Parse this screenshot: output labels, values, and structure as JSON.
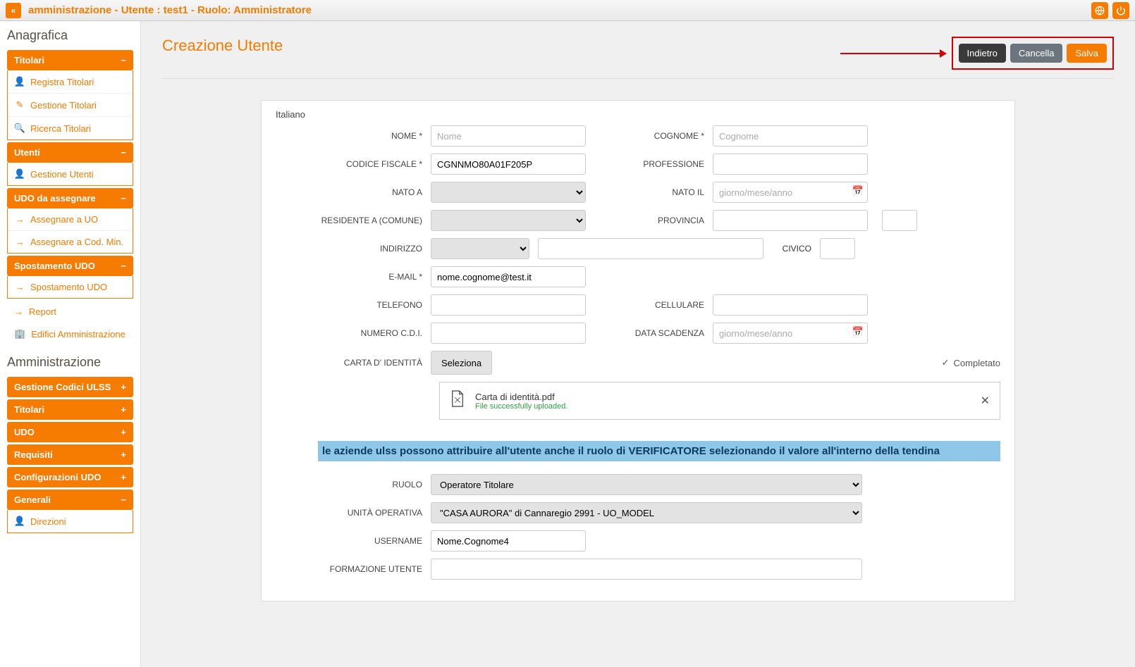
{
  "topbar": {
    "title": "amministrazione - Utente : test1 - Ruolo: Amministratore"
  },
  "sidebar": {
    "heading1": "Anagrafica",
    "titolari": {
      "label": "Titolari",
      "items": [
        "Registra Titolari",
        "Gestione Titolari",
        "Ricerca Titolari"
      ]
    },
    "utenti": {
      "label": "Utenti",
      "items": [
        "Gestione Utenti"
      ]
    },
    "udo_ass": {
      "label": "UDO da assegnare",
      "items": [
        "Assegnare a UO",
        "Assegnare a Cod. Min."
      ]
    },
    "spost": {
      "label": "Spostamento UDO",
      "items": [
        "Spostamento UDO"
      ]
    },
    "report": "Report",
    "edifici": "Edifici Amministrazione",
    "heading2": "Amministrazione",
    "admin": [
      "Gestione Codici ULSS",
      "Titolari",
      "UDO",
      "Requisiti",
      "Configurazioni UDO",
      "Generali"
    ],
    "direzioni": "Direzioni"
  },
  "page": {
    "title": "Creazione Utente",
    "back": "Indietro",
    "cancel": "Cancella",
    "save": "Salva"
  },
  "form": {
    "language": "Italiano",
    "labels": {
      "nome": "NOME *",
      "cognome": "COGNOME *",
      "cf": "CODICE FISCALE *",
      "professione": "PROFESSIONE",
      "natoa": "NATO A",
      "natoil": "NATO IL",
      "residente": "RESIDENTE A (COMUNE)",
      "provincia": "PROVINCIA",
      "indirizzo": "INDIRIZZO",
      "civico": "CIVICO",
      "email": "E-MAIL *",
      "telefono": "TELEFONO",
      "cellulare": "CELLULARE",
      "cdi": "NUMERO C.D.I.",
      "scadenza": "DATA SCADENZA",
      "carta": "CARTA D' IDENTITÀ",
      "ruolo": "RUOLO",
      "uo": "UNITÀ OPERATIVA",
      "username": "USERNAME",
      "formazione": "FORMAZIONE UTENTE"
    },
    "placeholders": {
      "nome": "Nome",
      "cognome": "Cognome",
      "date": "giorno/mese/anno"
    },
    "values": {
      "cf": "CGNNMO80A01F205P",
      "email": "nome.cognome@test.it",
      "ruolo": "Operatore Titolare",
      "uo": "\"CASA AURORA\" di Cannaregio 2991 - UO_MODEL",
      "username": "Nome.Cognome4"
    },
    "seleziona": "Seleziona",
    "completato": "Completato",
    "file": {
      "name": "Carta di identità.pdf",
      "msg": "File successfully uploaded."
    },
    "banner": "le aziende ulss possono attribuire all'utente anche il ruolo di VERIFICATORE selezionando il valore all'interno della tendina"
  }
}
